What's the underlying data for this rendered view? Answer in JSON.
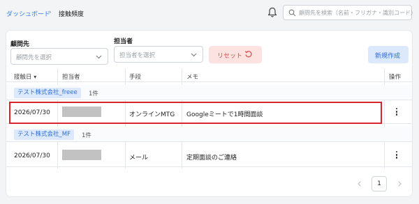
{
  "breadcrumb": {
    "parent": "ダッシュボード",
    "separator": "›",
    "current": "接触頻度"
  },
  "search": {
    "placeholder": "顧問先を検索（名前・フリガナ・識別コード）"
  },
  "filters": {
    "client": {
      "label": "顧問先",
      "placeholder": "顧問先を選択"
    },
    "staff": {
      "label": "担当者",
      "placeholder": "担当者を選択"
    },
    "reset_label": "リセット",
    "new_label": "新規作成"
  },
  "table": {
    "headers": {
      "date": "接触日",
      "staff": "担当者",
      "method": "手段",
      "memo": "メモ",
      "action": "操作"
    },
    "sort_indicator": "▾",
    "groups": [
      {
        "name": "テスト株式会社_freee",
        "count": "1件",
        "rows": [
          {
            "date": "2026/07/30",
            "staff": "",
            "method": "オンラインMTG",
            "memo": "Googleミートで1時間面談"
          }
        ]
      },
      {
        "name": "テスト株式会社_MF",
        "count": "1件",
        "rows": [
          {
            "date": "2026/07/30",
            "staff": "",
            "method": "メール",
            "memo": "定期面談のご連絡"
          }
        ]
      }
    ]
  },
  "pagination": {
    "current_page": "1"
  },
  "icons": {
    "bell": "bell-icon",
    "search": "search-icon",
    "chevron": "chevron-down-icon",
    "reset": "refresh-icon",
    "more": "more-vertical-icon"
  },
  "colors": {
    "accent": "#2f80ed",
    "danger": "#e24a4a",
    "highlight": "#d9232b"
  }
}
